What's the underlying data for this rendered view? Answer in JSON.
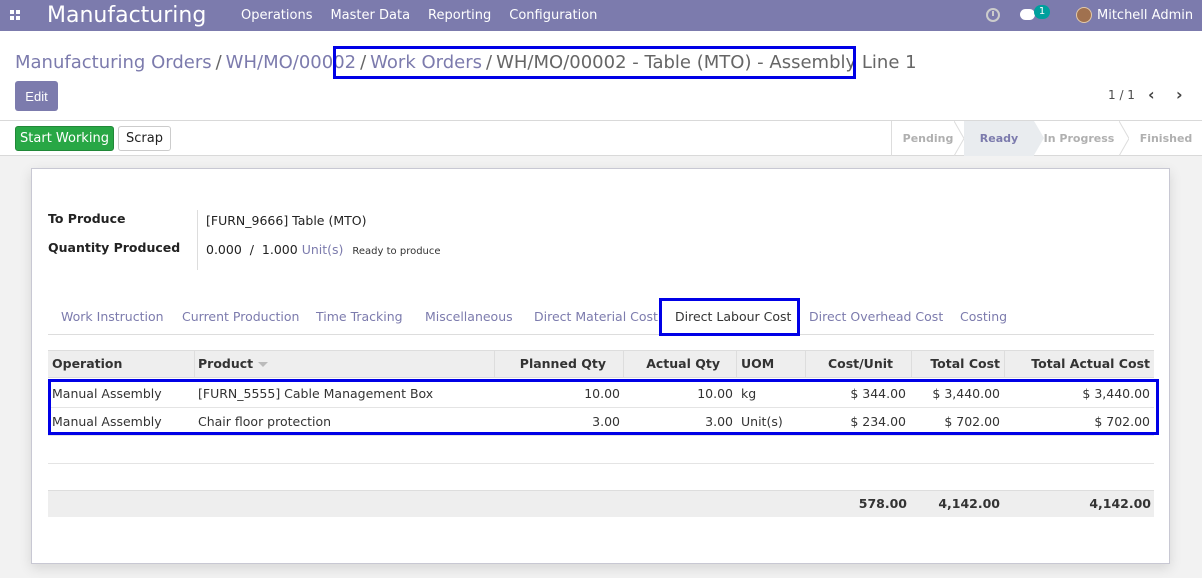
{
  "nav": {
    "app_title": "Manufacturing",
    "menu": [
      "Operations",
      "Master Data",
      "Reporting",
      "Configuration"
    ],
    "chat_count": "1",
    "user": "Mitchell Admin",
    "icons": {
      "apps": "apps-grid-icon",
      "activity": "clock-icon",
      "messages": "chat-icon"
    }
  },
  "breadcrumb": {
    "items": [
      "Manufacturing Orders",
      "WH/MO/00002",
      "Work Orders"
    ],
    "current": "WH/MO/00002 - Table (MTO) - Assembly Line 1",
    "separator": "/"
  },
  "actions": {
    "edit": "Edit"
  },
  "pager": {
    "value": "1 / 1",
    "prev": "‹",
    "next": "›"
  },
  "statusbar": {
    "buttons": {
      "start": "Start Working",
      "scrap": "Scrap"
    },
    "stages": [
      "Pending",
      "Ready",
      "In Progress",
      "Finished"
    ],
    "current_stage": "Ready"
  },
  "form": {
    "to_produce_label": "To Produce",
    "to_produce_value": "[FURN_9666] Table (MTO)",
    "qty_label": "Quantity Produced",
    "qty_done": "0.000",
    "qty_sep": "/",
    "qty_total": "1.000",
    "qty_uom": "Unit(s)",
    "qty_status": "Ready to produce"
  },
  "tabs": [
    "Work Instruction",
    "Current Production",
    "Time Tracking",
    "Miscellaneous",
    "Direct Material Cost",
    "Direct Labour Cost",
    "Direct Overhead Cost",
    "Costing"
  ],
  "active_tab": "Direct Labour Cost",
  "table": {
    "columns": [
      "Operation",
      "Product",
      "Planned Qty",
      "Actual Qty",
      "UOM",
      "Cost/Unit",
      "Total Cost",
      "Total Actual Cost"
    ],
    "rows": [
      [
        "Manual Assembly",
        "[FURN_5555] Cable Management Box",
        "10.00",
        "10.00",
        "kg",
        "$ 344.00",
        "$ 3,440.00",
        "$ 3,440.00"
      ],
      [
        "Manual Assembly",
        "Chair floor protection",
        "3.00",
        "3.00",
        "Unit(s)",
        "$ 234.00",
        "$ 702.00",
        "$ 702.00"
      ]
    ],
    "totals": {
      "cost_unit": "578.00",
      "total_cost": "4,142.00",
      "total_actual_cost": "4,142.00"
    }
  },
  "colors": {
    "brand": "#7c7bad",
    "success": "#28a745",
    "highlight": "#0000e6"
  }
}
